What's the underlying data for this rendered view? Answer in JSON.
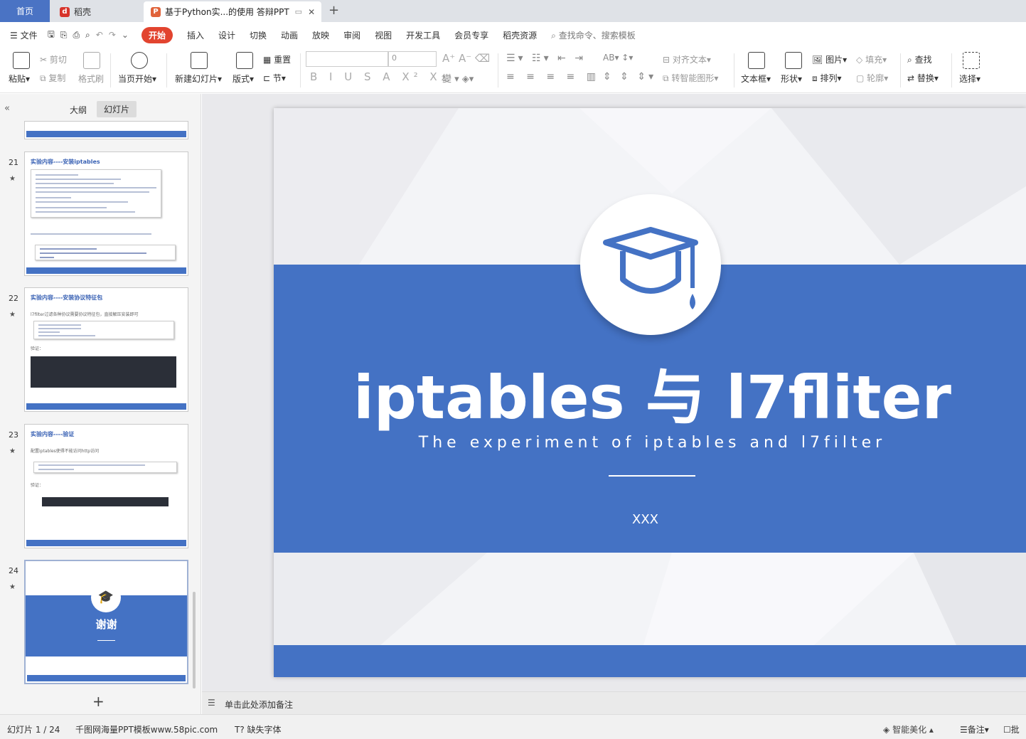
{
  "tabs": {
    "home": "首页",
    "daoke": "稻壳",
    "doc": "基于Python实...的使用 答辩PPT"
  },
  "menu": [
    "文件",
    "开始",
    "插入",
    "设计",
    "切换",
    "动画",
    "放映",
    "审阅",
    "视图",
    "开发工具",
    "会员专享",
    "稻壳资源"
  ],
  "menu_search": "查找命令、搜索模板",
  "toolbar": {
    "paste": "粘贴",
    "cut": "剪切",
    "copy": "复制",
    "format_painter": "格式刷",
    "from_current": "当页开始",
    "new_slide": "新建幻灯片",
    "layout": "版式",
    "reset": "重置",
    "section": "节",
    "font_size": "0",
    "align_text": "对齐文本",
    "smart_shape": "转智能图形",
    "textbox": "文本框",
    "shape": "形状",
    "picture": "图片",
    "arrange": "排列",
    "fill": "填充",
    "outline": "轮廓",
    "find": "查找",
    "replace": "替换",
    "select": "选择"
  },
  "panel": {
    "outline_tab": "大纲",
    "slides_tab": "幻灯片",
    "slides": [
      {
        "num": "21",
        "title": "实验内容----安装iptables"
      },
      {
        "num": "22",
        "title": "实验内容----安装协议特征包",
        "text": "l7filter过滤各种协议需要协议特征包，直接解压安装即可",
        "label": "验证："
      },
      {
        "num": "23",
        "title": "实验内容----验证",
        "text": "配置iptables使得不能访问http访问",
        "label": "验证："
      },
      {
        "num": "24",
        "title": "谢谢"
      }
    ]
  },
  "slide": {
    "title": "iptables 与 l7fliter",
    "subtitle": "The experiment of iptables and l7filter",
    "author": "XXX"
  },
  "notes_placeholder": "单击此处添加备注",
  "status": {
    "slide_counter": "幻灯片 1 / 24",
    "template": "千图网海量PPT模板www.58pic.com",
    "missing_font": "缺失字体",
    "beautify": "智能美化",
    "notes": "备注",
    "comment": "批"
  },
  "colors": {
    "accent": "#4472c4",
    "start_tab": "#e2442f",
    "home_tab": "#4a73c4"
  }
}
